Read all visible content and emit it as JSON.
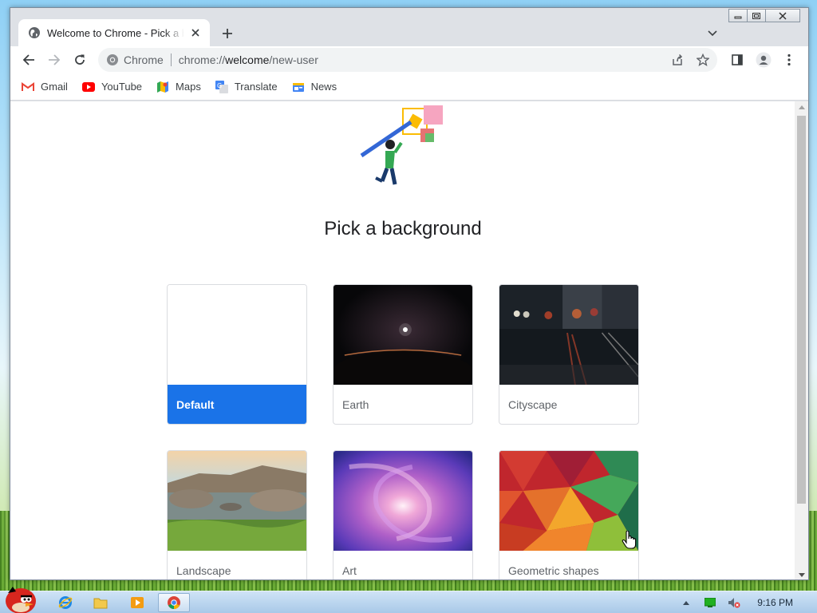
{
  "window": {
    "tab_title": "Welcome to Chrome - Pick a background",
    "colors": {
      "accent": "#1a73e8",
      "frame": "#dee1e6"
    }
  },
  "toolbar": {
    "omnibox_chip": "Chrome",
    "url_scheme": "chrome://",
    "url_host": "welcome",
    "url_path": "/new-user"
  },
  "bookmarks": [
    {
      "label": "Gmail",
      "icon": "gmail-icon"
    },
    {
      "label": "YouTube",
      "icon": "youtube-icon"
    },
    {
      "label": "Maps",
      "icon": "maps-icon"
    },
    {
      "label": "Translate",
      "icon": "translate-icon"
    },
    {
      "label": "News",
      "icon": "news-icon"
    }
  ],
  "page": {
    "heading": "Pick a background",
    "backgrounds": [
      {
        "label": "Default",
        "selected": true
      },
      {
        "label": "Earth",
        "selected": false
      },
      {
        "label": "Cityscape",
        "selected": false
      },
      {
        "label": "Landscape",
        "selected": false
      },
      {
        "label": "Art",
        "selected": false
      },
      {
        "label": "Geometric shapes",
        "selected": false
      }
    ]
  },
  "taskbar": {
    "apps": [
      "start-button",
      "internet-explorer",
      "file-explorer",
      "media-player",
      "chrome"
    ],
    "clock": "9:16 PM"
  }
}
